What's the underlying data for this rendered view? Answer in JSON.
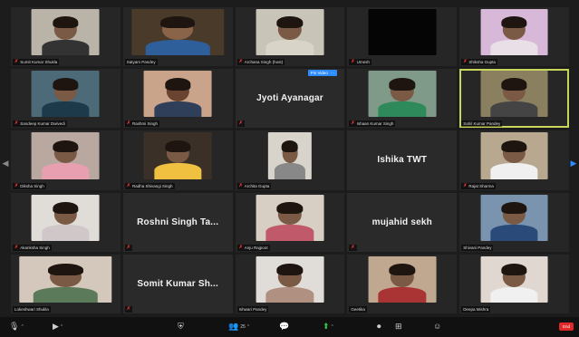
{
  "participants": [
    {
      "label": "Sumit Kumar Shukla",
      "display_name": "",
      "type": "video"
    },
    {
      "label": "Satyam Pandey",
      "display_name": "",
      "type": "video"
    },
    {
      "label": "Archana Singh (host)",
      "display_name": "",
      "type": "video"
    },
    {
      "label": "Umesh",
      "display_name": "",
      "type": "blank"
    },
    {
      "label": "Shiksha Gupta",
      "display_name": "",
      "type": "video"
    },
    {
      "label": "Sandeep Kumar Dwivedi",
      "display_name": "",
      "type": "video"
    },
    {
      "label": "Rashmi Singh",
      "display_name": "",
      "type": "video"
    },
    {
      "label": "",
      "display_name": "Jyoti Ayanagar",
      "type": "name"
    },
    {
      "label": "Ishaan Kumar Singh",
      "display_name": "",
      "type": "video"
    },
    {
      "label": "Sahil Kumar Pandey",
      "display_name": "",
      "type": "video"
    },
    {
      "label": "Diksha Singh",
      "display_name": "",
      "type": "video"
    },
    {
      "label": "Radha Shivangi Singh",
      "display_name": "",
      "type": "video"
    },
    {
      "label": "Archita Gupta",
      "display_name": "",
      "type": "video"
    },
    {
      "label": "",
      "display_name": "Ishika TWT",
      "type": "name"
    },
    {
      "label": "Rajat Sharma",
      "display_name": "",
      "type": "video"
    },
    {
      "label": "Akanksha Singh",
      "display_name": "",
      "type": "video"
    },
    {
      "label": "",
      "display_name": "Roshni Singh Ta...",
      "type": "name"
    },
    {
      "label": "Anju Rajpoot",
      "display_name": "",
      "type": "video"
    },
    {
      "label": "",
      "display_name": "mujahid sekh",
      "type": "name"
    },
    {
      "label": "Shivani Pandey",
      "display_name": "",
      "type": "video"
    },
    {
      "label": "Lokeshwari Shukla",
      "display_name": "",
      "type": "video"
    },
    {
      "label": "",
      "display_name": "Somit Kumar Sh...",
      "type": "name"
    },
    {
      "label": "Ishwari Pandey",
      "display_name": "",
      "type": "video"
    },
    {
      "label": "Geetika",
      "display_name": "",
      "type": "video"
    },
    {
      "label": "Deepa Mishra",
      "display_name": "",
      "type": "video"
    }
  ],
  "hover_button": {
    "label": "Pin Video",
    "more": "···"
  },
  "toolbar": {
    "participants_count": "25",
    "end_label": "End"
  },
  "colors": {
    "active_speaker": "#c7d65a",
    "accent": "#2d8cff",
    "end": "#e02828"
  }
}
